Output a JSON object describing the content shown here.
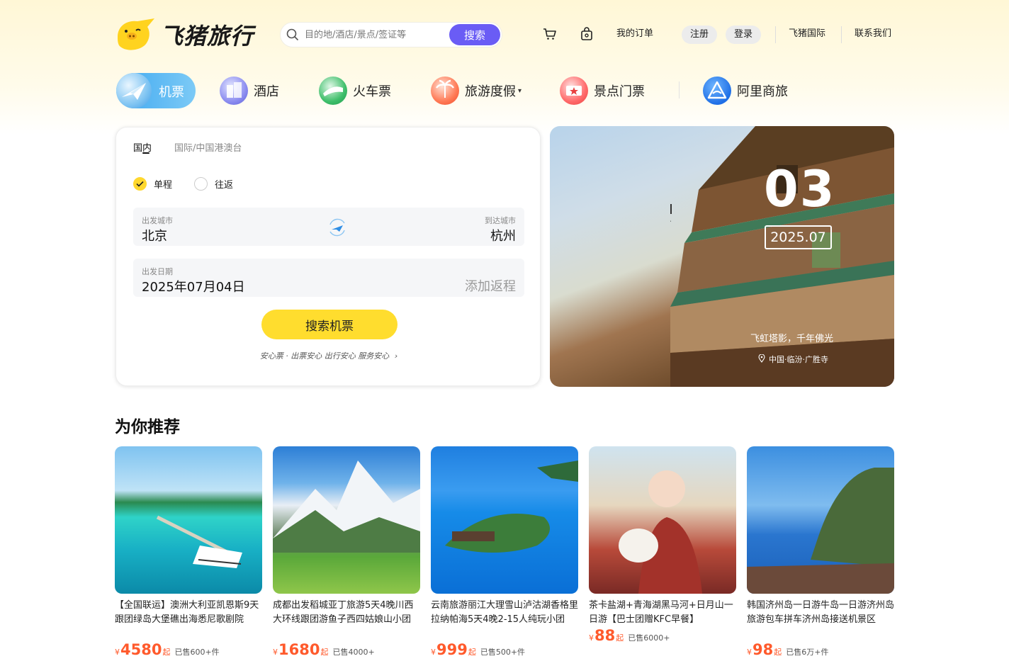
{
  "brand": {
    "name": "飞猪旅行"
  },
  "search": {
    "placeholder": "目的地/酒店/景点/签证等",
    "button": "搜索"
  },
  "header": {
    "my_orders": "我的订单",
    "register": "注册",
    "login": "登录",
    "intl": "飞猪国际",
    "contact": "联系我们"
  },
  "nav": {
    "items": [
      {
        "label": "机票",
        "icon": "plane-icon"
      },
      {
        "label": "酒店",
        "icon": "hotel-icon"
      },
      {
        "label": "火车票",
        "icon": "train-icon"
      },
      {
        "label": "旅游度假",
        "icon": "vacation-icon"
      },
      {
        "label": "景点门票",
        "icon": "ticket-icon"
      },
      {
        "label": "阿里商旅",
        "icon": "alibiz-icon"
      }
    ]
  },
  "booking": {
    "tabs": [
      "国内",
      "国际/中国港澳台"
    ],
    "trip_types": [
      "单程",
      "往返"
    ],
    "from_label": "出发城市",
    "from_value": "北京",
    "to_label": "到达城市",
    "to_value": "杭州",
    "date_label": "出发日期",
    "date_value": "2025年07月04日",
    "return_placeholder": "添加返程",
    "search_button": "搜索机票",
    "promise": "安心票 · 出票安心 出行安心 服务安心"
  },
  "banner": {
    "day": "03",
    "month": "2025.07",
    "caption": "飞虹塔影，千年佛光",
    "location": "中国·临汾·广胜寺"
  },
  "recommend": {
    "title": "为你推荐",
    "items": [
      {
        "name": "【全国联运】澳洲大利亚凯恩斯9天跟团绿岛大堡礁出海悉尼歌剧院",
        "yen": "¥",
        "price": "4580",
        "suffix": "起",
        "sold": "已售600+件"
      },
      {
        "name": "成都出发稻城亚丁旅游5天4晚川西大环线跟团游鱼子西四姑娘山小团",
        "yen": "¥",
        "price": "1680",
        "suffix": "起",
        "sold": "已售4000+"
      },
      {
        "name": "云南旅游丽江大理雪山泸沽湖香格里拉纳帕海5天4晚2-15人纯玩小团",
        "yen": "¥",
        "price": "999",
        "suffix": "起",
        "sold": "已售500+件"
      },
      {
        "name": "茶卡盐湖+青海湖黑马河+日月山一日游【巴士团赠KFC早餐】",
        "yen": "¥",
        "price": "88",
        "suffix": "起",
        "sold": "已售6000+"
      },
      {
        "name": "韩国济州岛一日游牛岛一日游济州岛旅游包车拼车济州岛接送机景区",
        "yen": "¥",
        "price": "98",
        "suffix": "起",
        "sold": "已售6万+件"
      }
    ]
  }
}
